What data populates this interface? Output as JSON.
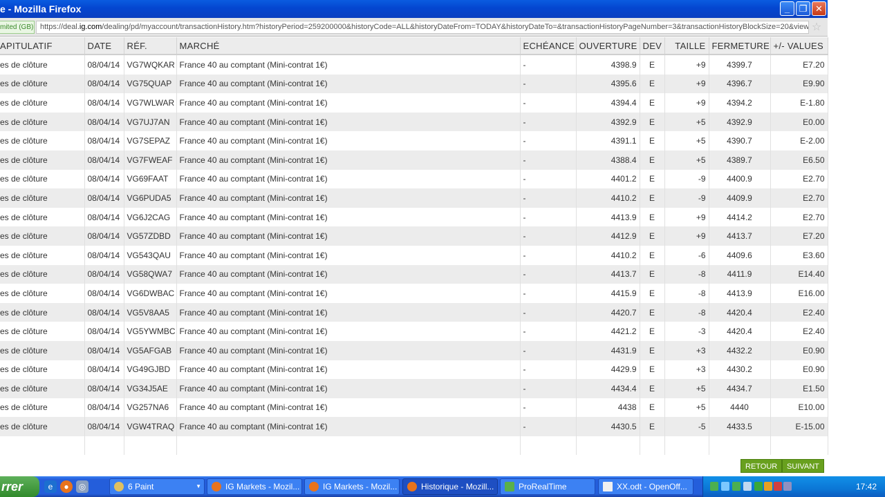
{
  "window": {
    "title": "e - Mozilla Firefox",
    "minimize_glyph": "_",
    "maximize_glyph": "❐",
    "close_glyph": "✕"
  },
  "address_bar": {
    "identity_label": "mited (GB)",
    "url_prefix": "https://deal.",
    "url_domain": "ig.com",
    "url_path": "/dealing/pd/myaccount/transactionHistory.htm?historyPeriod=259200000&historyCode=ALL&historyDateFrom=TODAY&historyDateTo=&transactionHistoryPageNumber=3&transactionHistoryBlockSize=20&view=",
    "bookmark_icon": "star-icon"
  },
  "table": {
    "headers": [
      "APITULATIF",
      "DATE",
      "RÉF.",
      "MARCHÉ",
      "ECHÉANCE",
      "OUVERTURE",
      "DEV",
      "TAILLE",
      "FERMETURE",
      "+/- VALUES"
    ],
    "rows": [
      {
        "type": "es de clôture",
        "date": "08/04/14",
        "ref": "VG7WQKAR",
        "market": "France 40 au comptant (Mini-contrat 1€)",
        "expiry": "-",
        "open": "4398.9",
        "dev": "E",
        "size": "+9",
        "close": "4399.7",
        "pl": "E7.20"
      },
      {
        "type": "es de clôture",
        "date": "08/04/14",
        "ref": "VG75QUAP",
        "market": "France 40 au comptant (Mini-contrat 1€)",
        "expiry": "-",
        "open": "4395.6",
        "dev": "E",
        "size": "+9",
        "close": "4396.7",
        "pl": "E9.90"
      },
      {
        "type": "es de clôture",
        "date": "08/04/14",
        "ref": "VG7WLWAR",
        "market": "France 40 au comptant (Mini-contrat 1€)",
        "expiry": "-",
        "open": "4394.4",
        "dev": "E",
        "size": "+9",
        "close": "4394.2",
        "pl": "E-1.80"
      },
      {
        "type": "es de clôture",
        "date": "08/04/14",
        "ref": "VG7UJ7AN",
        "market": "France 40 au comptant (Mini-contrat 1€)",
        "expiry": "-",
        "open": "4392.9",
        "dev": "E",
        "size": "+5",
        "close": "4392.9",
        "pl": "E0.00"
      },
      {
        "type": "es de clôture",
        "date": "08/04/14",
        "ref": "VG7SEPAZ",
        "market": "France 40 au comptant (Mini-contrat 1€)",
        "expiry": "-",
        "open": "4391.1",
        "dev": "E",
        "size": "+5",
        "close": "4390.7",
        "pl": "E-2.00"
      },
      {
        "type": "es de clôture",
        "date": "08/04/14",
        "ref": "VG7FWEAF",
        "market": "France 40 au comptant (Mini-contrat 1€)",
        "expiry": "-",
        "open": "4388.4",
        "dev": "E",
        "size": "+5",
        "close": "4389.7",
        "pl": "E6.50"
      },
      {
        "type": "es de clôture",
        "date": "08/04/14",
        "ref": "VG69FAAT",
        "market": "France 40 au comptant (Mini-contrat 1€)",
        "expiry": "-",
        "open": "4401.2",
        "dev": "E",
        "size": "-9",
        "close": "4400.9",
        "pl": "E2.70"
      },
      {
        "type": "es de clôture",
        "date": "08/04/14",
        "ref": "VG6PUDA5",
        "market": "France 40 au comptant (Mini-contrat 1€)",
        "expiry": "-",
        "open": "4410.2",
        "dev": "E",
        "size": "-9",
        "close": "4409.9",
        "pl": "E2.70"
      },
      {
        "type": "es de clôture",
        "date": "08/04/14",
        "ref": "VG6J2CAG",
        "market": "France 40 au comptant (Mini-contrat 1€)",
        "expiry": "-",
        "open": "4413.9",
        "dev": "E",
        "size": "+9",
        "close": "4414.2",
        "pl": "E2.70"
      },
      {
        "type": "es de clôture",
        "date": "08/04/14",
        "ref": "VG57ZDBD",
        "market": "France 40 au comptant (Mini-contrat 1€)",
        "expiry": "-",
        "open": "4412.9",
        "dev": "E",
        "size": "+9",
        "close": "4413.7",
        "pl": "E7.20"
      },
      {
        "type": "es de clôture",
        "date": "08/04/14",
        "ref": "VG543QAU",
        "market": "France 40 au comptant (Mini-contrat 1€)",
        "expiry": "-",
        "open": "4410.2",
        "dev": "E",
        "size": "-6",
        "close": "4409.6",
        "pl": "E3.60"
      },
      {
        "type": "es de clôture",
        "date": "08/04/14",
        "ref": "VG58QWA7",
        "market": "France 40 au comptant (Mini-contrat 1€)",
        "expiry": "-",
        "open": "4413.7",
        "dev": "E",
        "size": "-8",
        "close": "4411.9",
        "pl": "E14.40"
      },
      {
        "type": "es de clôture",
        "date": "08/04/14",
        "ref": "VG6DWBAC",
        "market": "France 40 au comptant (Mini-contrat 1€)",
        "expiry": "-",
        "open": "4415.9",
        "dev": "E",
        "size": "-8",
        "close": "4413.9",
        "pl": "E16.00"
      },
      {
        "type": "es de clôture",
        "date": "08/04/14",
        "ref": "VG5V8AA5",
        "market": "France 40 au comptant (Mini-contrat 1€)",
        "expiry": "-",
        "open": "4420.7",
        "dev": "E",
        "size": "-8",
        "close": "4420.4",
        "pl": "E2.40"
      },
      {
        "type": "es de clôture",
        "date": "08/04/14",
        "ref": "VG5YWMBC",
        "market": "France 40 au comptant (Mini-contrat 1€)",
        "expiry": "-",
        "open": "4421.2",
        "dev": "E",
        "size": "-3",
        "close": "4420.4",
        "pl": "E2.40"
      },
      {
        "type": "es de clôture",
        "date": "08/04/14",
        "ref": "VG5AFGAB",
        "market": "France 40 au comptant (Mini-contrat 1€)",
        "expiry": "-",
        "open": "4431.9",
        "dev": "E",
        "size": "+3",
        "close": "4432.2",
        "pl": "E0.90"
      },
      {
        "type": "es de clôture",
        "date": "08/04/14",
        "ref": "VG49GJBD",
        "market": "France 40 au comptant (Mini-contrat 1€)",
        "expiry": "-",
        "open": "4429.9",
        "dev": "E",
        "size": "+3",
        "close": "4430.2",
        "pl": "E0.90"
      },
      {
        "type": "es de clôture",
        "date": "08/04/14",
        "ref": "VG34J5AE",
        "market": "France 40 au comptant (Mini-contrat 1€)",
        "expiry": "-",
        "open": "4434.4",
        "dev": "E",
        "size": "+5",
        "close": "4434.7",
        "pl": "E1.50"
      },
      {
        "type": "es de clôture",
        "date": "08/04/14",
        "ref": "VG257NA6",
        "market": "France 40 au comptant (Mini-contrat 1€)",
        "expiry": "-",
        "open": "4438",
        "dev": "E",
        "size": "+5",
        "close": "4440",
        "pl": "E10.00"
      },
      {
        "type": "es de clôture",
        "date": "08/04/14",
        "ref": "VGW4TRAQ",
        "market": "France 40 au comptant (Mini-contrat 1€)",
        "expiry": "-",
        "open": "4430.5",
        "dev": "E",
        "size": "-5",
        "close": "4433.5",
        "pl": "E-15.00"
      }
    ]
  },
  "pager": {
    "back_label": "RETOUR",
    "next_label": "SUIVANT",
    "color": "#68a01e"
  },
  "taskbar": {
    "start_label": "rrer",
    "quick_launch": [
      "ie-icon",
      "firefox-icon",
      "media-icon"
    ],
    "buttons": [
      {
        "label": "6 Paint",
        "icon": "paint-icon",
        "active": false,
        "group": true
      },
      {
        "label": "IG Markets - Mozil...",
        "icon": "firefox-icon",
        "active": false
      },
      {
        "label": "IG Markets - Mozil...",
        "icon": "firefox-icon",
        "active": false
      },
      {
        "label": "Historique - Mozill...",
        "icon": "firefox-icon",
        "active": true
      },
      {
        "label": "ProRealTime",
        "icon": "chart-icon",
        "active": false
      },
      {
        "label": "XX.odt - OpenOff...",
        "icon": "document-icon",
        "active": false
      }
    ],
    "clock": "17:42",
    "accent": "#245edb"
  }
}
